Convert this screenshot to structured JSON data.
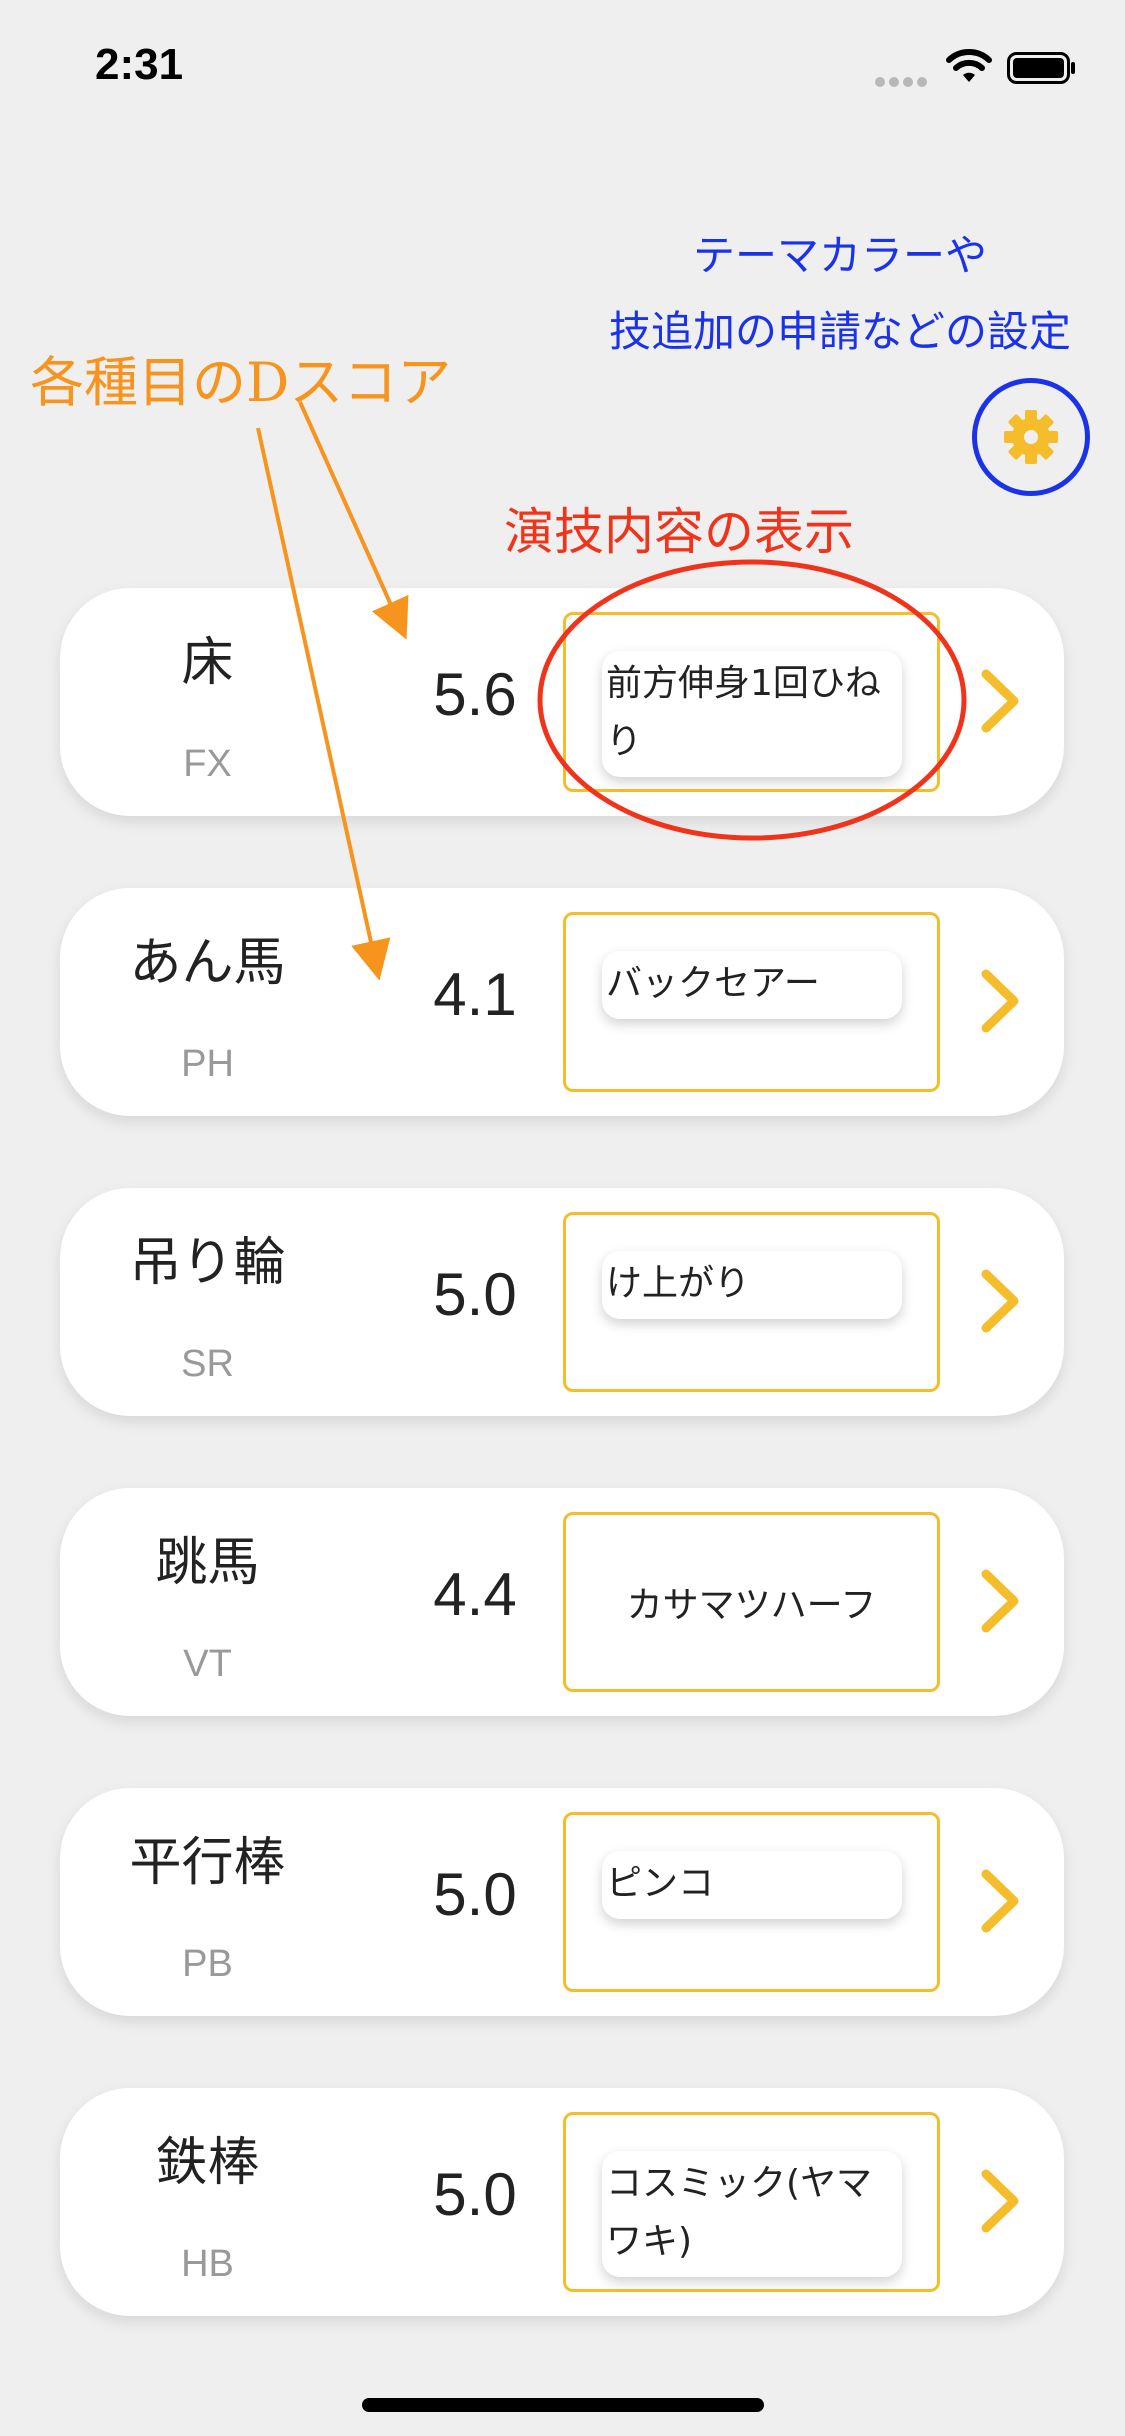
{
  "status_bar": {
    "time": "2:31"
  },
  "annotations": {
    "settings_note": [
      "テーマカラーや",
      "技追加の申請などの設定"
    ],
    "dscore_note": "各種目のDスコア",
    "content_note": "演技内容の表示"
  },
  "colors": {
    "accent": "#f5bd2c",
    "annotation_blue": "#1b33e8",
    "annotation_orange": "#f7941d",
    "annotation_red": "#f0341c"
  },
  "icons": {
    "settings": "gear-icon",
    "row_action": "chevron-right-icon"
  },
  "events": [
    {
      "name": "床",
      "code": "FX",
      "score": "5.6",
      "skill": "前方伸身1回ひねり",
      "skill_style": "pill"
    },
    {
      "name": "あん馬",
      "code": "PH",
      "score": "4.1",
      "skill": "バックセアー",
      "skill_style": "pill"
    },
    {
      "name": "吊り輪",
      "code": "SR",
      "score": "5.0",
      "skill": "け上がり",
      "skill_style": "pill"
    },
    {
      "name": "跳馬",
      "code": "VT",
      "score": "4.4",
      "skill": "カサマツハーフ",
      "skill_style": "plain"
    },
    {
      "name": "平行棒",
      "code": "PB",
      "score": "5.0",
      "skill": "ピンコ",
      "skill_style": "pill"
    },
    {
      "name": "鉄棒",
      "code": "HB",
      "score": "5.0",
      "skill": "コスミック(ヤマワキ)",
      "skill_style": "pill"
    }
  ]
}
